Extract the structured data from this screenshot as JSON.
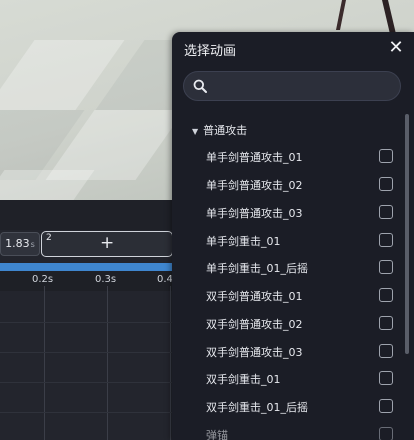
{
  "timeline": {
    "current_time": "1.83",
    "time_unit": "s",
    "clip_index": "2",
    "add_label": "+",
    "ticks": [
      "0.2s",
      "0.3s",
      "0.4"
    ]
  },
  "panel": {
    "title": "选择动画",
    "close_glyph": "✕",
    "search_placeholder": "",
    "group": {
      "caret": "▼",
      "label": "普通攻击"
    },
    "items": [
      "单手剑普通攻击_01",
      "单手剑普通攻击_02",
      "单手剑普通攻击_03",
      "单手剑重击_01",
      "单手剑重击_01_后摇",
      "双手剑普通攻击_01",
      "双手剑普通攻击_02",
      "双手剑普通攻击_03",
      "双手剑重击_01",
      "双手剑重击_01_后摇",
      "弹锚"
    ]
  },
  "colors": {
    "panel_bg": "#1b1d26",
    "timeline_bg": "#23252d",
    "accent_blue": "#3f86cf"
  },
  "icons": [
    "search-icon",
    "close-icon",
    "caret-down-icon",
    "checkbox-icon"
  ]
}
